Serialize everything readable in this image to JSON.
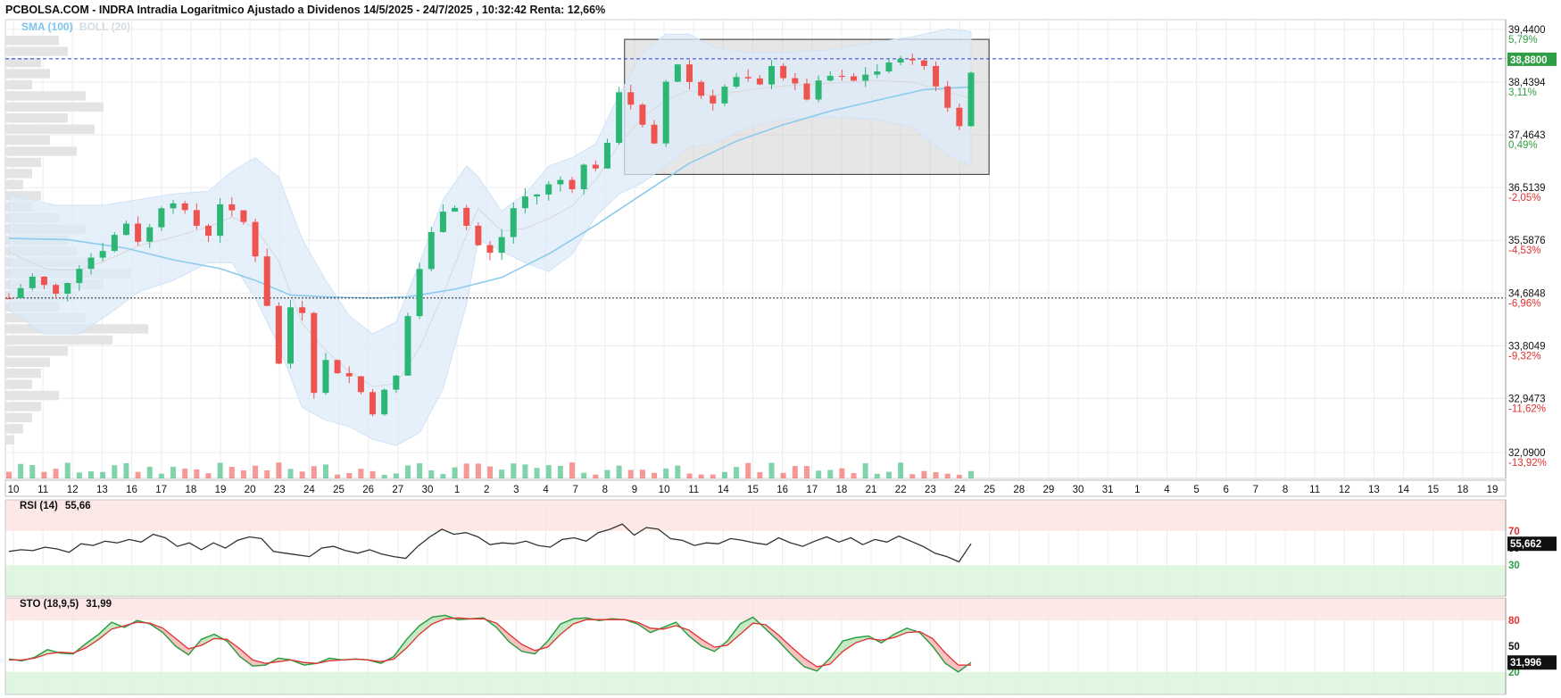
{
  "title": "PCBOLSA.COM - INDRA Intradia Logaritmico Ajustado a Dividenos 14/5/2025 - 24/7/2025 , 10:32:42 Renta: 12,66%",
  "legend": {
    "sma": "SMA (100)",
    "boll": "BOLL (20)"
  },
  "colors": {
    "up": "#2bb673",
    "down": "#ef5350",
    "boll_fill": "#dcebfa",
    "sma": "#8ccbec",
    "ref_line": "#2f3fd6",
    "rsi_line": "#333333",
    "sto_k": "#2f9e44",
    "sto_d": "#e03131"
  },
  "chart_data": [
    {
      "type": "candlestick",
      "scale": "log",
      "ylim": [
        32.09,
        39.44
      ],
      "y_ticks": [
        {
          "value": "39,4400",
          "pct": "5,79%"
        },
        {
          "value": "38,4394",
          "pct": "3,11%"
        },
        {
          "value": "37,4643",
          "pct": "0,49%"
        },
        {
          "value": "36,5139",
          "pct": "-2,05%"
        },
        {
          "value": "35,5876",
          "pct": "-4,53%"
        },
        {
          "value": "34,6848",
          "pct": "-6,96%"
        },
        {
          "value": "33,8049",
          "pct": "-9,32%"
        },
        {
          "value": "32,9473",
          "pct": "-11,62%"
        },
        {
          "value": "32,0900",
          "pct": "-13,92%"
        }
      ],
      "last_price_label": "38,8800",
      "reference_price": 34.6,
      "x_labels": [
        "10",
        "11",
        "12",
        "13",
        "16",
        "17",
        "18",
        "19",
        "20",
        "23",
        "24",
        "25",
        "26",
        "27",
        "30",
        "1",
        "2",
        "3",
        "4",
        "7",
        "8",
        "9",
        "10",
        "11",
        "14",
        "15",
        "16",
        "17",
        "18",
        "21",
        "22",
        "23",
        "24",
        "25",
        "28",
        "29",
        "30",
        "31",
        "1",
        "4",
        "5",
        "6",
        "7",
        "8",
        "11",
        "12",
        "13",
        "14",
        "15",
        "18",
        "19"
      ],
      "close_path": [
        [
          0,
          34.6
        ],
        [
          2,
          34.95
        ],
        [
          4,
          34.65
        ],
        [
          6,
          35.15
        ],
        [
          8,
          35.45
        ],
        [
          10,
          35.9
        ],
        [
          11,
          35.6
        ],
        [
          12,
          35.8
        ],
        [
          13,
          36.2
        ],
        [
          14,
          36.3
        ],
        [
          15,
          36.05
        ],
        [
          16,
          35.85
        ],
        [
          17,
          35.7
        ],
        [
          18,
          36.25
        ],
        [
          19,
          36.05
        ],
        [
          20,
          35.9
        ],
        [
          21,
          35.35
        ],
        [
          22,
          34.5
        ],
        [
          23,
          33.5
        ],
        [
          24,
          34.45
        ],
        [
          25,
          34.4
        ],
        [
          26,
          33.1
        ],
        [
          27,
          33.55
        ],
        [
          28,
          33.4
        ],
        [
          29,
          33.3
        ],
        [
          30,
          33.05
        ],
        [
          31,
          32.75
        ],
        [
          32,
          33.05
        ],
        [
          33,
          33.3
        ],
        [
          34,
          34.3
        ],
        [
          35,
          35.1
        ],
        [
          36,
          35.7
        ],
        [
          37,
          36.15
        ],
        [
          38,
          36.2
        ],
        [
          39,
          35.85
        ],
        [
          40,
          35.5
        ],
        [
          41,
          35.35
        ],
        [
          42,
          35.65
        ],
        [
          43,
          36.15
        ],
        [
          44,
          36.35
        ],
        [
          45,
          36.4
        ],
        [
          46,
          36.55
        ],
        [
          47,
          36.65
        ],
        [
          48,
          36.55
        ],
        [
          49,
          36.9
        ],
        [
          50,
          36.9
        ],
        [
          51,
          37.25
        ],
        [
          52,
          38.3
        ],
        [
          53,
          38.05
        ],
        [
          54,
          37.6
        ],
        [
          55,
          37.25
        ],
        [
          56,
          38.45
        ],
        [
          57,
          38.8
        ],
        [
          58,
          38.45
        ],
        [
          59,
          38.2
        ],
        [
          60,
          38.1
        ],
        [
          61,
          38.35
        ],
        [
          62,
          38.5
        ],
        [
          63,
          38.45
        ],
        [
          64,
          38.35
        ],
        [
          65,
          38.8
        ],
        [
          66,
          38.55
        ],
        [
          67,
          38.35
        ],
        [
          68,
          38.15
        ],
        [
          69,
          38.4
        ],
        [
          70,
          38.55
        ],
        [
          71,
          38.5
        ],
        [
          72,
          38.45
        ],
        [
          73,
          38.6
        ],
        [
          74,
          38.65
        ],
        [
          75,
          38.75
        ],
        [
          76,
          38.95
        ],
        [
          77,
          38.8
        ],
        [
          78,
          38.75
        ],
        [
          79,
          38.4
        ],
        [
          80,
          37.95
        ],
        [
          81,
          37.7
        ],
        [
          82,
          38.6
        ]
      ],
      "sma": [
        [
          0,
          35.62
        ],
        [
          5,
          35.6
        ],
        [
          10,
          35.45
        ],
        [
          14,
          35.25
        ],
        [
          18,
          35.1
        ],
        [
          21,
          34.9
        ],
        [
          24,
          34.65
        ],
        [
          27,
          34.62
        ],
        [
          31,
          34.6
        ],
        [
          34,
          34.62
        ],
        [
          38,
          34.75
        ],
        [
          42,
          34.95
        ],
        [
          46,
          35.35
        ],
        [
          50,
          35.85
        ],
        [
          54,
          36.4
        ],
        [
          58,
          36.95
        ],
        [
          62,
          37.35
        ],
        [
          66,
          37.65
        ],
        [
          70,
          37.9
        ],
        [
          74,
          38.1
        ],
        [
          78,
          38.3
        ],
        [
          82,
          38.35
        ]
      ],
      "boll_upper": [
        [
          0,
          36.4
        ],
        [
          4,
          36.2
        ],
        [
          8,
          36.2
        ],
        [
          11,
          36.3
        ],
        [
          14,
          36.4
        ],
        [
          17,
          36.45
        ],
        [
          19,
          36.8
        ],
        [
          21,
          37.05
        ],
        [
          23,
          36.7
        ],
        [
          25,
          35.6
        ],
        [
          27,
          34.9
        ],
        [
          29,
          34.3
        ],
        [
          31,
          34.0
        ],
        [
          33,
          34.2
        ],
        [
          35,
          35.2
        ],
        [
          37,
          36.3
        ],
        [
          39,
          36.9
        ],
        [
          40,
          36.7
        ],
        [
          42,
          36.1
        ],
        [
          44,
          36.4
        ],
        [
          46,
          36.9
        ],
        [
          48,
          37.05
        ],
        [
          50,
          37.3
        ],
        [
          52,
          38.2
        ],
        [
          54,
          39.0
        ],
        [
          56,
          39.35
        ],
        [
          58,
          39.35
        ],
        [
          60,
          39.1
        ],
        [
          63,
          39.0
        ],
        [
          66,
          39.0
        ],
        [
          70,
          39.05
        ],
        [
          74,
          39.2
        ],
        [
          77,
          39.3
        ],
        [
          80,
          39.45
        ],
        [
          82,
          39.4
        ]
      ],
      "boll_lower": [
        [
          0,
          34.4
        ],
        [
          3,
          34.0
        ],
        [
          6,
          34.0
        ],
        [
          9,
          34.4
        ],
        [
          11,
          34.7
        ],
        [
          14,
          34.9
        ],
        [
          17,
          35.2
        ],
        [
          19,
          35.2
        ],
        [
          21,
          34.6
        ],
        [
          23,
          33.8
        ],
        [
          25,
          32.8
        ],
        [
          27,
          32.6
        ],
        [
          29,
          32.5
        ],
        [
          31,
          32.3
        ],
        [
          33,
          32.2
        ],
        [
          35,
          32.4
        ],
        [
          37,
          33.1
        ],
        [
          39,
          34.5
        ],
        [
          40,
          35.6
        ],
        [
          42,
          35.4
        ],
        [
          44,
          35.2
        ],
        [
          46,
          35.05
        ],
        [
          48,
          35.35
        ],
        [
          50,
          36.0
        ],
        [
          52,
          36.4
        ],
        [
          54,
          36.6
        ],
        [
          56,
          36.9
        ],
        [
          58,
          37.25
        ],
        [
          60,
          37.3
        ],
        [
          63,
          37.6
        ],
        [
          66,
          37.75
        ],
        [
          70,
          37.8
        ],
        [
          74,
          37.75
        ],
        [
          77,
          37.6
        ],
        [
          80,
          37.1
        ],
        [
          82,
          36.9
        ]
      ],
      "range_box": {
        "from": 53,
        "to": 83,
        "high": 39.25,
        "low": 36.75
      }
    },
    {
      "type": "line",
      "name": "RSI (14)",
      "last": "55,66",
      "last_label": "55,662",
      "levels": [
        "70",
        "50",
        "30"
      ],
      "values": [
        46,
        48,
        47,
        51,
        49,
        45,
        55,
        53,
        58,
        56,
        60,
        57,
        66,
        62,
        52,
        56,
        48,
        56,
        50,
        59,
        63,
        61,
        46,
        44,
        42,
        40,
        50,
        52,
        47,
        44,
        48,
        43,
        40,
        38,
        52,
        63,
        72,
        66,
        68,
        63,
        54,
        56,
        55,
        58,
        53,
        51,
        60,
        62,
        58,
        68,
        72,
        78,
        65,
        74,
        72,
        61,
        59,
        53,
        56,
        55,
        61,
        59,
        56,
        54,
        62,
        56,
        52,
        58,
        63,
        57,
        62,
        54,
        60,
        57,
        64,
        58,
        52,
        44,
        40,
        34,
        55
      ]
    },
    {
      "type": "line",
      "name": "STO (18,9,5)",
      "last": "31,99",
      "last_label": "31,996",
      "levels": [
        "80",
        "50",
        "20"
      ],
      "k": [
        35,
        33,
        37,
        46,
        42,
        41,
        53,
        64,
        78,
        72,
        80,
        76,
        66,
        50,
        40,
        58,
        64,
        56,
        38,
        27,
        28,
        36,
        34,
        28,
        30,
        36,
        34,
        35,
        34,
        30,
        38,
        58,
        74,
        84,
        86,
        81,
        82,
        83,
        72,
        55,
        44,
        41,
        56,
        76,
        82,
        83,
        80,
        82,
        81,
        76,
        66,
        72,
        78,
        62,
        50,
        44,
        56,
        76,
        84,
        70,
        56,
        40,
        26,
        21,
        36,
        56,
        60,
        62,
        54,
        64,
        71,
        66,
        50,
        30,
        20,
        31
      ],
      "d": [
        34,
        34,
        36,
        41,
        43,
        42,
        48,
        58,
        70,
        74,
        78,
        77,
        71,
        59,
        47,
        51,
        59,
        58,
        47,
        34,
        30,
        32,
        34,
        31,
        30,
        33,
        34,
        35,
        34,
        32,
        35,
        48,
        64,
        76,
        82,
        83,
        82,
        82,
        77,
        64,
        52,
        45,
        49,
        64,
        76,
        81,
        81,
        81,
        81,
        78,
        71,
        70,
        74,
        69,
        58,
        49,
        51,
        64,
        77,
        75,
        63,
        49,
        36,
        26,
        29,
        44,
        54,
        59,
        57,
        60,
        66,
        67,
        59,
        42,
        28,
        28
      ]
    }
  ]
}
